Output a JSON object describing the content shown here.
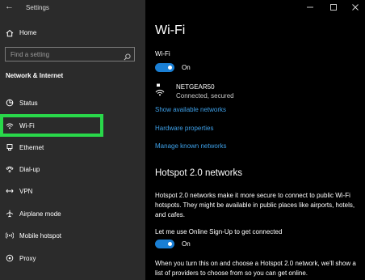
{
  "window": {
    "title": "Settings"
  },
  "sidebar": {
    "home_label": "Home",
    "search_placeholder": "Find a setting",
    "section_title": "Network & Internet",
    "items": [
      {
        "label": "Status",
        "icon": "status-icon"
      },
      {
        "label": "Wi-Fi",
        "icon": "wifi-icon"
      },
      {
        "label": "Ethernet",
        "icon": "ethernet-icon"
      },
      {
        "label": "Dial-up",
        "icon": "dialup-icon"
      },
      {
        "label": "VPN",
        "icon": "vpn-icon"
      },
      {
        "label": "Airplane mode",
        "icon": "airplane-icon"
      },
      {
        "label": "Mobile hotspot",
        "icon": "hotspot-icon"
      },
      {
        "label": "Proxy",
        "icon": "proxy-icon"
      }
    ],
    "selected_item": "Wi-Fi",
    "highlight_color": "#29d84a"
  },
  "main": {
    "title": "Wi-Fi",
    "wifi_label": "Wi-Fi",
    "wifi_toggle_state": "On",
    "network": {
      "name": "NETGEAR50",
      "status": "Connected, secured"
    },
    "links": {
      "show_networks": "Show available networks",
      "hardware_properties": "Hardware properties",
      "manage_networks": "Manage known networks"
    },
    "hotspot_heading": "Hotspot 2.0 networks",
    "hotspot_description": "Hotspot 2.0 networks make it more secure to connect to public Wi-Fi hotspots. They might be available in public places like airports, hotels, and cafes.",
    "signup_label": "Let me use Online Sign-Up to get connected",
    "signup_toggle_state": "On",
    "footer_text": "When you turn this on and choose a Hotspot 2.0 network, we'll show a list of providers to choose from so you can get online."
  },
  "colors": {
    "accent": "#1a7fd4",
    "link": "#3ea0e8",
    "sidebar_bg": "#2b2b2b",
    "main_bg": "#000000"
  }
}
